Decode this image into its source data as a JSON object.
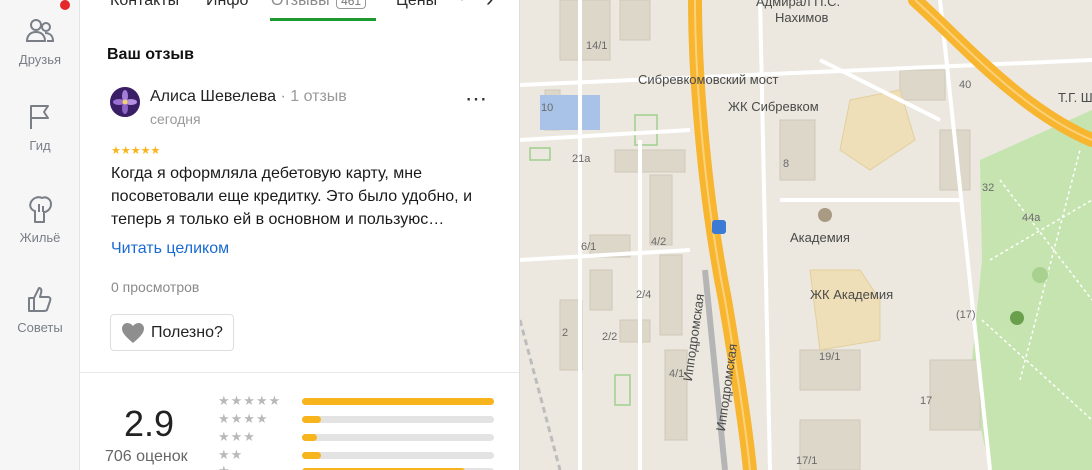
{
  "rail": {
    "items": [
      {
        "label": "Друзья",
        "icon": "friends-icon"
      },
      {
        "label": "Гид",
        "icon": "flag-icon"
      },
      {
        "label": "Жильё",
        "icon": "house-icon"
      },
      {
        "label": "Советы",
        "icon": "thumbs-up-icon"
      }
    ],
    "notification_color": "#e5262b"
  },
  "tabs": {
    "items": [
      "Контакты",
      "Инфо",
      "Отзывы",
      "Цены"
    ],
    "reviews_count": "461",
    "active": "Отзывы",
    "next_icon": "chevron-right-icon"
  },
  "review": {
    "section_title": "Ваш отзыв",
    "author": "Алиса Шевелева",
    "author_reviews": "1 отзыв",
    "date": "сегодня",
    "rating": 5,
    "stars": "★★★★★",
    "text": "Когда я оформляла дебетовую карту, мне посоветовали еще кредитку. Это было удобно, и теперь я только ей в основном и пользуюс…",
    "read_more": "Читать целиком",
    "views": "0 просмотров",
    "useful_label": "Полезно?",
    "more_icon": "⋯"
  },
  "summary": {
    "rating": "2.9",
    "count": "706 оценок",
    "distribution": [
      {
        "stars": "★★★★★",
        "fraction": 1.0
      },
      {
        "stars": "★★★★",
        "fraction": 0.1
      },
      {
        "stars": "★★★",
        "fraction": 0.08
      },
      {
        "stars": "★★",
        "fraction": 0.1
      },
      {
        "stars": "★",
        "fraction": 0.85
      }
    ],
    "accent_color": "#f7b41c"
  },
  "map": {
    "labels": {
      "bridge": "Сибревкомовский мост",
      "admiral": "Адмирал П.С.",
      "nakhimov": "Нахимов",
      "zhk_sibrevkom": "ЖК Сибревком",
      "akademia": "Академия",
      "zhk_akademia": "ЖК Академия",
      "street1": "Ипподромская",
      "street2": "Ипподромская",
      "shevchenko": "Т.Г. Шевч"
    },
    "house_numbers": [
      "14/1",
      "10",
      "21а",
      "8",
      "6/1",
      "4/2",
      "2/4",
      "2",
      "2/2",
      "4/1",
      "19/1",
      "17",
      "17/1",
      "40",
      "32",
      "44а",
      "(17)"
    ],
    "road_color": "#f7b530"
  }
}
